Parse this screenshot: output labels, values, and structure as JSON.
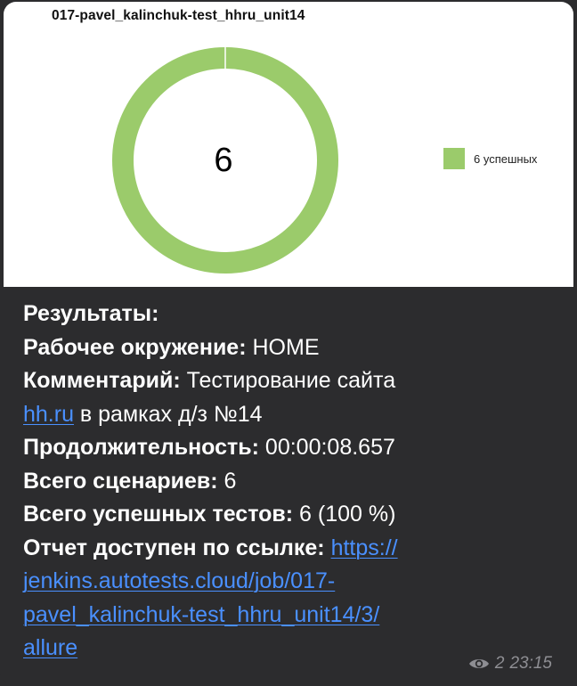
{
  "chart_data": {
    "type": "pie",
    "title": "017-pavel_kalinchuk-test_hhru_unit14",
    "center_label": "6",
    "slices": [
      {
        "label": "6 успешных",
        "value": 6,
        "color": "#9bcb6b"
      }
    ],
    "legend_placement": "right"
  },
  "message": {
    "lines": [
      {
        "label": "Результаты:",
        "value": ""
      },
      {
        "label": "Рабочее окружение:",
        "value": " HOME"
      },
      {
        "label": "Комментарий:",
        "value": " Тестирование сайта"
      }
    ],
    "comment_link": "hh.ru",
    "comment_tail": " в рамках д/з №14",
    "duration_label": "Продолжительность:",
    "duration_value": " 00:00:08.657",
    "scenarios_label": "Всего сценариев:",
    "scenarios_value": " 6",
    "passed_label": "Всего успешных тестов:",
    "passed_value": " 6 (100 %)",
    "report_label": "Отчет доступен по ссылке:",
    "report_link_parts": [
      "https://",
      "jenkins.autotests.cloud/job/017-",
      "pavel_kalinchuk-test_hhru_unit14/3/",
      "allure"
    ]
  },
  "footer": {
    "views": "2",
    "time": "23:15",
    "icon": "eye-icon",
    "color": "#8e8e93"
  },
  "colors": {
    "background": "#2c2c2e",
    "link": "#4a90ff",
    "text": "#ffffff"
  }
}
